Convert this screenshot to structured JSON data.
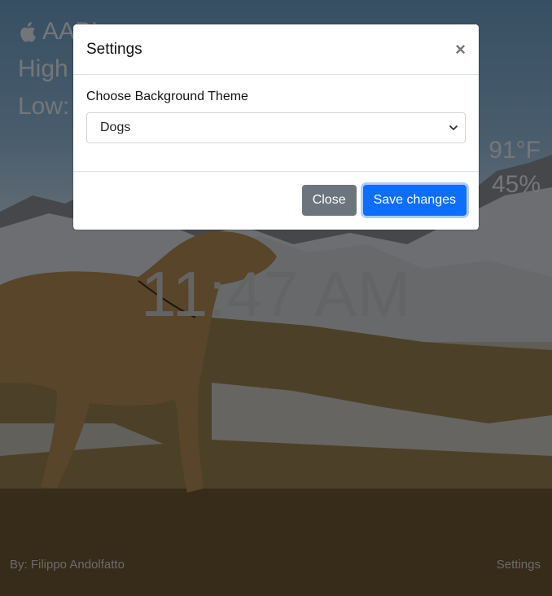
{
  "ticker": {
    "symbol": "AAPL",
    "high_label": "High",
    "low_label": "Low:"
  },
  "weather": {
    "temp": "91°F",
    "humidity": "45%"
  },
  "clock": {
    "time": "11:47 AM"
  },
  "footer": {
    "author": "By: Filippo Andolfatto",
    "settings_link": "Settings"
  },
  "modal": {
    "title": "Settings",
    "close_icon_text": "×",
    "field_label": "Choose Background Theme",
    "select_value": "Dogs",
    "close_button": "Close",
    "save_button": "Save changes"
  },
  "colors": {
    "primary": "#0d6efd",
    "secondary": "#6c757d",
    "backdrop": "#000000"
  }
}
